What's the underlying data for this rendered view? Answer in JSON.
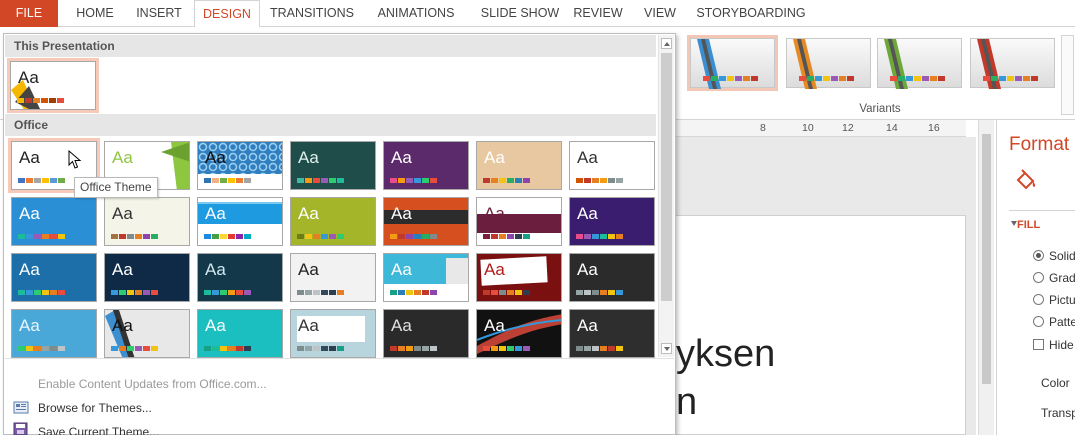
{
  "tabs": [
    {
      "label": "FILE",
      "kind": "file"
    },
    {
      "label": "HOME"
    },
    {
      "label": "INSERT"
    },
    {
      "label": "DESIGN",
      "kind": "active"
    },
    {
      "label": "TRANSITIONS"
    },
    {
      "label": "ANIMATIONS"
    },
    {
      "label": "SLIDE SHOW"
    },
    {
      "label": "REVIEW"
    },
    {
      "label": "VIEW"
    },
    {
      "label": "STORYBOARDING"
    }
  ],
  "ribbon": {
    "variants_label": "Variants",
    "variants": [
      {
        "stripe": "#3b8fd0",
        "selected": true
      },
      {
        "stripe": "#e58a25"
      },
      {
        "stripe": "#6ea83b"
      },
      {
        "stripe": "#c0392b"
      }
    ]
  },
  "gallery": {
    "this_presentation_label": "This Presentation",
    "office_label": "Office",
    "current_theme": {
      "aa": "Aa",
      "bg": "#ffffff",
      "fg": "#222222",
      "swatches": [
        "#f5b800",
        "#c0392b",
        "#e67e22",
        "#d35400",
        "#a04000",
        "#e74c3c"
      ]
    },
    "themes": [
      {
        "aa": "Aa",
        "bg": "#ffffff",
        "fg": "#222222",
        "swatches": [
          "#4472c4",
          "#ed7d31",
          "#a5a5a5",
          "#ffc000",
          "#5b9bd5",
          "#70ad47"
        ],
        "selected": true
      },
      {
        "aa": "Aa",
        "bg": "#ffffff",
        "fg": "#8dc63f",
        "swatches": [
          "#8dc63f",
          "#6aa12f",
          "#b1d46e",
          "#f0a30a",
          "#d9d9d9",
          "#4a7d1c"
        ],
        "deco": "facet"
      },
      {
        "aa": "Aa",
        "bg": "#2f7fc0",
        "fg": "#111111",
        "swatches": [
          "#2e75b6",
          "#f4b183",
          "#70ad47",
          "#ffc000",
          "#ed7d31",
          "#a5a5a5"
        ],
        "deco": "pattern"
      },
      {
        "aa": "Aa",
        "bg": "#1f4e4a",
        "fg": "#e0f0ee",
        "swatches": [
          "#3fb9a0",
          "#f39c12",
          "#e74c3c",
          "#9b59b6",
          "#2ecc71",
          "#1abc9c"
        ]
      },
      {
        "aa": "Aa",
        "bg": "#5b2a6b",
        "fg": "#ffffff",
        "swatches": [
          "#e84c8b",
          "#f39c12",
          "#9b59b6",
          "#3498db",
          "#2ecc71",
          "#e74c3c"
        ]
      },
      {
        "aa": "Aa",
        "bg": "#e8c8a0",
        "fg": "#ffffff",
        "swatches": [
          "#c0392b",
          "#e67e22",
          "#f1c40f",
          "#27ae60",
          "#2980b9",
          "#8e44ad"
        ]
      },
      {
        "aa": "Aa",
        "bg": "#ffffff",
        "fg": "#333333",
        "swatches": [
          "#d35400",
          "#c0392b",
          "#e67e22",
          "#f39c12",
          "#7f8c8d",
          "#95a5a6"
        ]
      },
      {
        "aa": "Aa",
        "bg": "#2b8fd6",
        "fg": "#ffffff",
        "swatches": [
          "#1abc9c",
          "#3498db",
          "#9b59b6",
          "#e67e22",
          "#e74c3c",
          "#f1c40f"
        ]
      },
      {
        "aa": "Aa",
        "bg": "#f4f4e8",
        "fg": "#333333",
        "swatches": [
          "#a3743f",
          "#c0392b",
          "#7f8c8d",
          "#e67e22",
          "#8e44ad",
          "#27ae60"
        ]
      },
      {
        "aa": "Aa",
        "bg": "#ffffff",
        "fg": "#ffffff",
        "swatches": [
          "#1e88e5",
          "#43a047",
          "#fdd835",
          "#e53935",
          "#8e24aa",
          "#00acc1"
        ],
        "deco": "bluebar"
      },
      {
        "aa": "Aa",
        "bg": "#a4b52a",
        "fg": "#ffffff",
        "swatches": [
          "#6b7d18",
          "#f1c40f",
          "#e67e22",
          "#3498db",
          "#9b59b6",
          "#2ecc71"
        ]
      },
      {
        "aa": "Aa",
        "bg": "#d5501e",
        "fg": "#ffffff",
        "swatches": [
          "#f39c12",
          "#c0392b",
          "#8e44ad",
          "#2980b9",
          "#27ae60",
          "#7f8c8d"
        ],
        "deco": "darkband"
      },
      {
        "aa": "Aa",
        "bg": "#ffffff",
        "fg": "#6b1e3e",
        "swatches": [
          "#7b1e3e",
          "#c0392b",
          "#e67e22",
          "#8e44ad",
          "#2c3e50",
          "#16a085"
        ],
        "deco": "maroon"
      },
      {
        "aa": "Aa",
        "bg": "#3a1d6e",
        "fg": "#ffffff",
        "swatches": [
          "#e84c8b",
          "#9b59b6",
          "#3498db",
          "#1abc9c",
          "#f1c40f",
          "#e67e22"
        ]
      },
      {
        "aa": "Aa",
        "bg": "#1c6fa8",
        "fg": "#ffffff",
        "swatches": [
          "#1abc9c",
          "#3498db",
          "#2ecc71",
          "#f1c40f",
          "#e67e22",
          "#e74c3c"
        ]
      },
      {
        "aa": "Aa",
        "bg": "#0e2a47",
        "fg": "#ffffff",
        "swatches": [
          "#3498db",
          "#2ecc71",
          "#f1c40f",
          "#e67e22",
          "#9b59b6",
          "#e74c3c"
        ]
      },
      {
        "aa": "Aa",
        "bg": "#12384a",
        "fg": "#cfe8f0",
        "swatches": [
          "#1abc9c",
          "#3498db",
          "#2ecc71",
          "#f39c12",
          "#e74c3c",
          "#9b59b6"
        ]
      },
      {
        "aa": "Aa",
        "bg": "#f2f2f2",
        "fg": "#222222",
        "swatches": [
          "#7f8c8d",
          "#95a5a6",
          "#bdc3c7",
          "#34495e",
          "#2c3e50",
          "#e67e22"
        ]
      },
      {
        "aa": "Aa",
        "bg": "#3db8d8",
        "fg": "#ffffff",
        "swatches": [
          "#16a085",
          "#2980b9",
          "#f1c40f",
          "#e67e22",
          "#c0392b",
          "#8e44ad"
        ],
        "deco": "cyan"
      },
      {
        "aa": "Aa",
        "bg": "#ffffff",
        "fg": "#b01c1c",
        "swatches": [
          "#c0392b",
          "#e74c3c",
          "#7f8c8d",
          "#e67e22",
          "#f1c40f",
          "#2c3e50"
        ],
        "deco": "redbox"
      },
      {
        "aa": "Aa",
        "bg": "#2b2b2b",
        "fg": "#ffffff",
        "swatches": [
          "#95a5a6",
          "#bdc3c7",
          "#7f8c8d",
          "#e67e22",
          "#f1c40f",
          "#3498db"
        ]
      },
      {
        "aa": "Aa",
        "bg": "#4aa8d8",
        "fg": "#e8f6fc",
        "swatches": [
          "#2ecc71",
          "#f1c40f",
          "#e67e22",
          "#95a5a6",
          "#7f8c8d",
          "#bdc3c7"
        ]
      },
      {
        "aa": "Aa",
        "bg": "#e8e8e8",
        "fg": "#111111",
        "swatches": [
          "#3498db",
          "#e67e22",
          "#2ecc71",
          "#9b59b6",
          "#e74c3c",
          "#f1c40f"
        ],
        "deco": "ribbon"
      },
      {
        "aa": "Aa",
        "bg": "#1bbfbf",
        "fg": "#ffffff",
        "swatches": [
          "#16a085",
          "#1abc9c",
          "#f1c40f",
          "#e67e22",
          "#c0392b",
          "#2c3e50"
        ]
      },
      {
        "aa": "Aa",
        "bg": "#b8d4dc",
        "fg": "#333333",
        "swatches": [
          "#7f8c8d",
          "#95a5a6",
          "#bdc3c7",
          "#34495e",
          "#2c3e50",
          "#16a085"
        ],
        "deco": "whitebox"
      },
      {
        "aa": "Aa",
        "bg": "#2a2a2a",
        "fg": "#e0e0e0",
        "swatches": [
          "#c0392b",
          "#e67e22",
          "#f39c12",
          "#7f8c8d",
          "#95a5a6",
          "#bdc3c7"
        ]
      },
      {
        "aa": "Aa",
        "bg": "#111111",
        "fg": "#ffffff",
        "swatches": [
          "#e74c3c",
          "#f39c12",
          "#f1c40f",
          "#2ecc71",
          "#3498db",
          "#9b59b6"
        ],
        "deco": "flare"
      },
      {
        "aa": "Aa",
        "bg": "#2e2e2e",
        "fg": "#ffffff",
        "swatches": [
          "#7f8c8d",
          "#95a5a6",
          "#bdc3c7",
          "#e67e22",
          "#c0392b",
          "#f1c40f"
        ]
      }
    ],
    "tooltip": "Office Theme"
  },
  "menu": {
    "enable_updates": "Enable Content Updates from Office.com...",
    "browse": "Browse for Themes...",
    "save": "Save Current Theme..."
  },
  "ruler": [
    "8",
    "10",
    "12",
    "14",
    "16"
  ],
  "slide": {
    "line1": "yksen",
    "line2": "n"
  },
  "format_pane": {
    "title": "Format",
    "fill_label": "FILL",
    "options": [
      "Solid",
      "Grad",
      "Pictu",
      "Patte"
    ],
    "hide_label": "Hide",
    "color_label": "Color",
    "transp_label": "Transp"
  }
}
